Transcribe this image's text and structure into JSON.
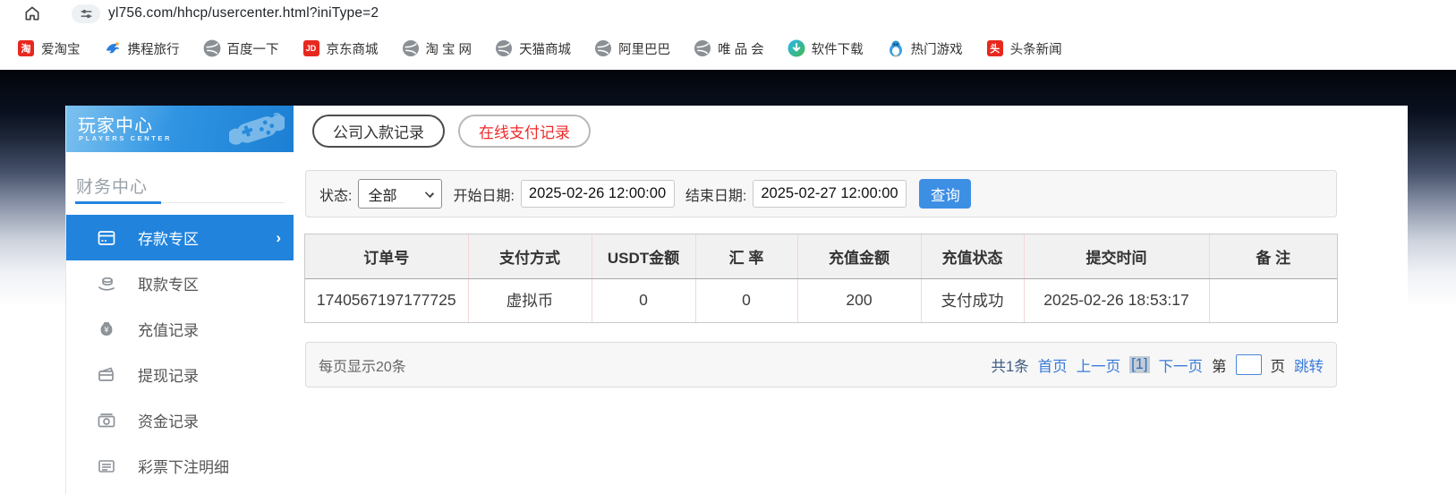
{
  "browser": {
    "url": "yl756.com/hhcp/usercenter.html?iniType=2",
    "bookmarks": [
      {
        "label": "爱淘宝",
        "glyph": "淘"
      },
      {
        "label": "携程旅行"
      },
      {
        "label": "百度一下"
      },
      {
        "label": "京东商城",
        "glyph": "JD"
      },
      {
        "label": "淘 宝 网"
      },
      {
        "label": "天猫商城"
      },
      {
        "label": "阿里巴巴"
      },
      {
        "label": "唯 品 会"
      },
      {
        "label": "软件下载"
      },
      {
        "label": "热门游戏"
      },
      {
        "label": "头条新闻",
        "glyph": "头"
      }
    ]
  },
  "sidebar": {
    "title": "玩家中心",
    "subtitle": "PLAYERS CENTER",
    "section": "财务中心",
    "menu": [
      {
        "label": "存款专区"
      },
      {
        "label": "取款专区"
      },
      {
        "label": "充值记录"
      },
      {
        "label": "提现记录"
      },
      {
        "label": "资金记录"
      },
      {
        "label": "彩票下注明细"
      }
    ],
    "active_chevron": "›"
  },
  "tabs": [
    {
      "label": "公司入款记录"
    },
    {
      "label": "在线支付记录"
    }
  ],
  "filter": {
    "status_label": "状态:",
    "status_value": "全部",
    "start_label": "开始日期:",
    "start_value": "2025-02-26 12:00:00",
    "end_label": "结束日期:",
    "end_value": "2025-02-27 12:00:00",
    "search_label": "查询"
  },
  "table": {
    "headers": [
      "订单号",
      "支付方式",
      "USDT金额",
      "汇 率",
      "充值金额",
      "充值状态",
      "提交时间",
      "备 注"
    ],
    "rows": [
      [
        "1740567197177725",
        "虚拟币",
        "0",
        "0",
        "200",
        "支付成功",
        "2025-02-26 18:53:17",
        ""
      ]
    ]
  },
  "pagination": {
    "page_size_text": "每页显示20条",
    "total_text": "共1条",
    "first": "首页",
    "prev": "上一页",
    "current": "[1]",
    "next": "下一页",
    "jump_pre": "第",
    "jump_post": "页",
    "jump_label": "跳转"
  },
  "colors": {
    "accent_blue": "#2183dc",
    "link_blue": "#3a7bd8",
    "tab_red": "#ef2b2b",
    "banner_blue_start": "#58b0eb",
    "banner_blue_end": "#1c7fd3"
  }
}
